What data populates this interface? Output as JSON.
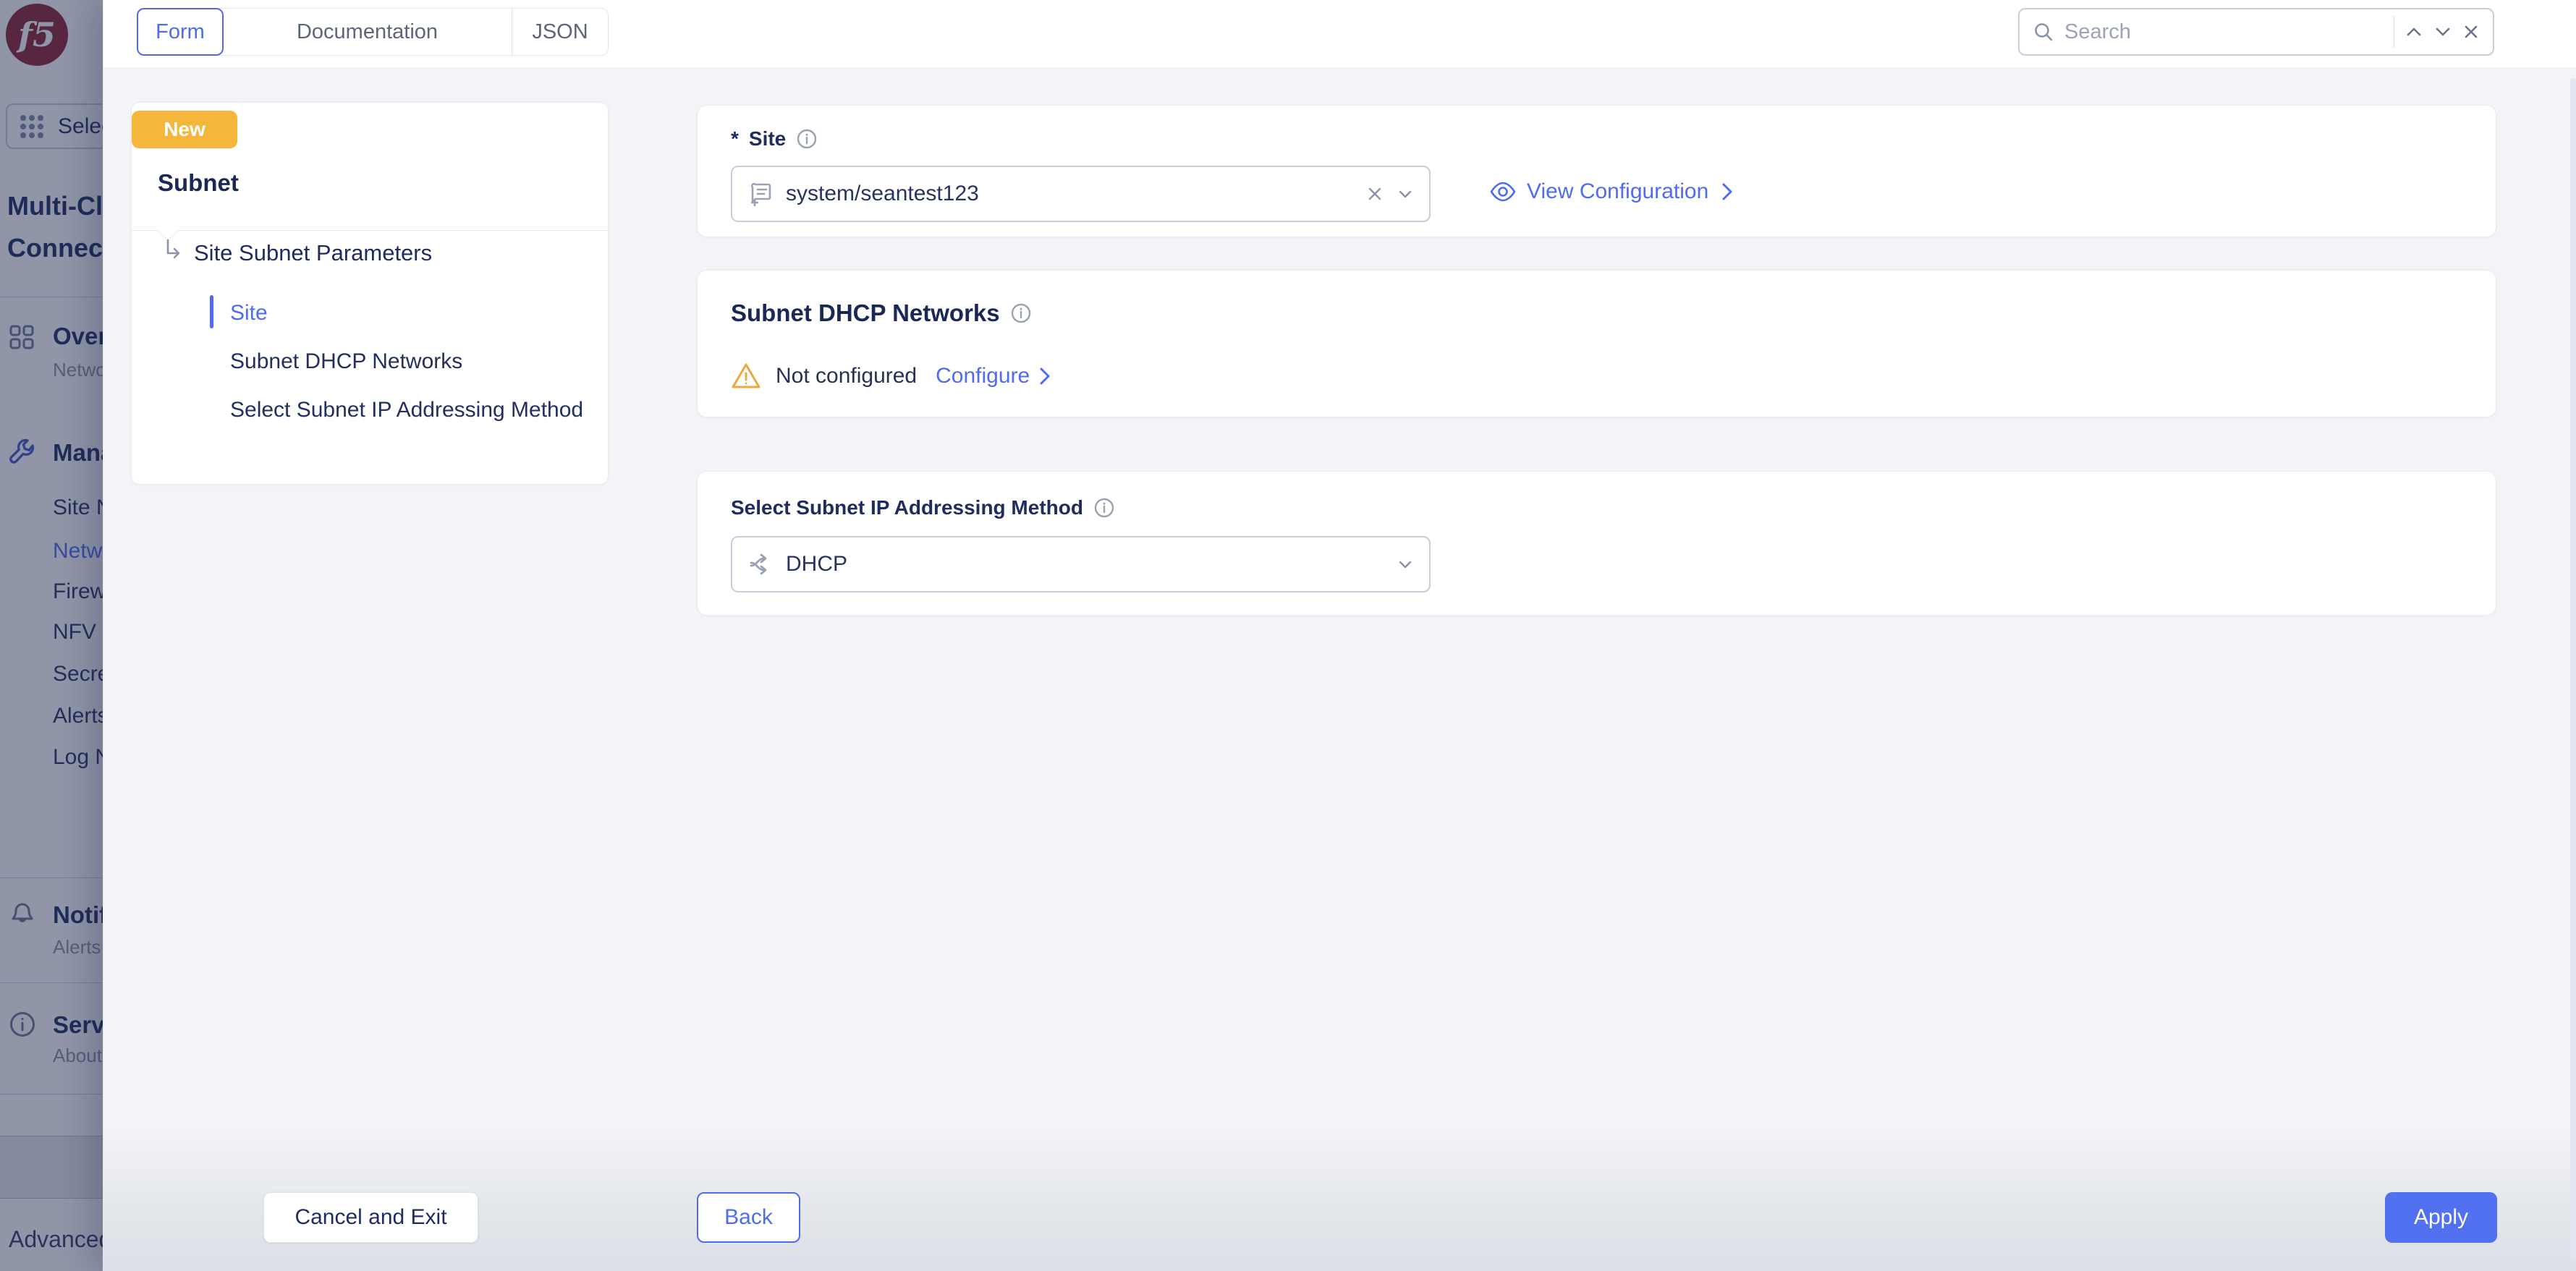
{
  "topbar": {
    "tabs": [
      {
        "label": "Form"
      },
      {
        "label": "Documentation"
      },
      {
        "label": "JSON"
      }
    ],
    "search_placeholder": "Search"
  },
  "sidebar": {
    "app_switcher_label": "Select",
    "workspace_line1": "Multi-Cl",
    "workspace_line2": "Connect",
    "overview_label": "Overview",
    "overview_sub": "Network",
    "manage_label": "Manage",
    "manage_items": [
      {
        "label": "Site Net"
      },
      {
        "label": "Networking",
        "active": true
      },
      {
        "label": "Firewall"
      },
      {
        "label": "NFV Ser"
      },
      {
        "label": "Secrets"
      },
      {
        "label": "Alerts M"
      },
      {
        "label": "Log Net"
      }
    ],
    "notifications_label": "Notific",
    "notifications_sub": "Alerts",
    "service_label": "Service",
    "service_sub": "About",
    "advanced_label": "Advanced"
  },
  "wizard": {
    "badge": "New",
    "title": "Subnet",
    "tree": {
      "parent": "Site Subnet Parameters",
      "children": [
        {
          "label": "Site",
          "active": true
        },
        {
          "label": "Subnet DHCP Networks"
        },
        {
          "label": "Select Subnet IP Addressing Method"
        }
      ]
    }
  },
  "form": {
    "site": {
      "required_mark": "*",
      "label": "Site",
      "value": "system/seantest123",
      "view_link": "View Configuration"
    },
    "dhcp": {
      "title": "Subnet DHCP Networks",
      "status": "Not configured",
      "action": "Configure"
    },
    "method": {
      "label": "Select Subnet IP Addressing Method",
      "value": "DHCP"
    }
  },
  "footer": {
    "cancel": "Cancel and Exit",
    "back": "Back",
    "apply": "Apply"
  },
  "colors": {
    "accent": "#4f6bf0",
    "navy": "#1e2c5e",
    "badge": "#f5b63c",
    "warning": "#eaa83e",
    "brand": "#8c2332"
  }
}
